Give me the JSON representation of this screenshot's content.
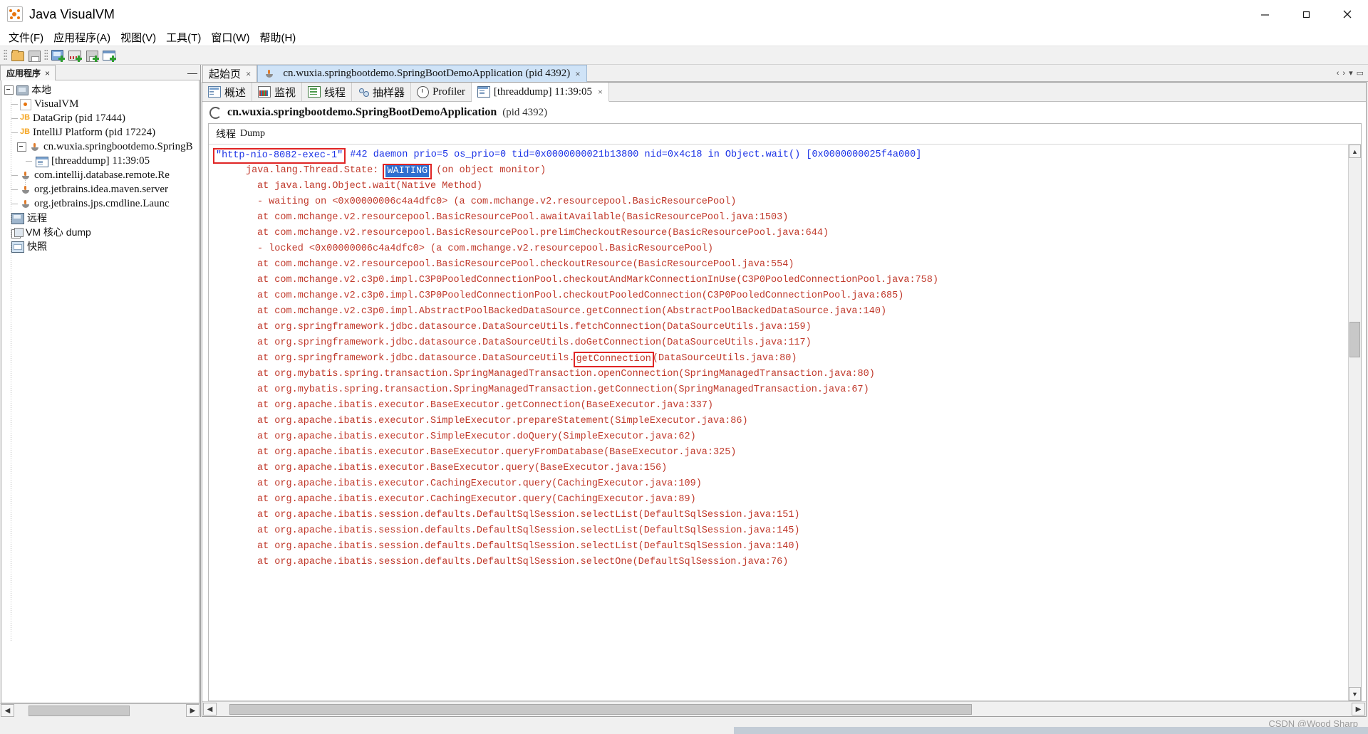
{
  "window": {
    "title": "Java VisualVM",
    "app_icon": "visualvm-icon",
    "minimize": "minimize-icon",
    "maximize": "maximize-icon",
    "close": "close-icon"
  },
  "menubar": {
    "items": [
      {
        "label": "文件(F)",
        "mnemonic": "F"
      },
      {
        "label": "应用程序(A)",
        "mnemonic": "A"
      },
      {
        "label": "视图(V)",
        "mnemonic": "V"
      },
      {
        "label": "工具(T)",
        "mnemonic": "T"
      },
      {
        "label": "窗口(W)",
        "mnemonic": "W"
      },
      {
        "label": "帮助(H)",
        "mnemonic": "H"
      }
    ]
  },
  "toolbar": {
    "buttons": [
      {
        "name": "open-file-icon"
      },
      {
        "name": "save-icon"
      },
      {
        "name": "add-jmx-connection-icon"
      },
      {
        "name": "add-remote-host-icon"
      },
      {
        "name": "add-vm-coredump-icon"
      },
      {
        "name": "add-snapshot-icon"
      }
    ]
  },
  "left_panel": {
    "tab_label": "应用程序",
    "tab_close": "×",
    "minimize_glyph": "—",
    "tree": [
      {
        "label": "本地",
        "depth": 0,
        "icon": "local-host-icon",
        "expandable": true,
        "expanded": true,
        "cjk": true
      },
      {
        "label": "VisualVM",
        "depth": 1,
        "icon": "visualvm-icon",
        "expandable": false,
        "cjk": false
      },
      {
        "label": "DataGrip (pid 17444)",
        "depth": 1,
        "icon": "jetbrains-icon",
        "expandable": false,
        "cjk": false
      },
      {
        "label": "IntelliJ Platform (pid 17224)",
        "depth": 1,
        "icon": "jetbrains-icon",
        "expandable": false,
        "cjk": false
      },
      {
        "label": "cn.wuxia.springbootdemo.SpringB",
        "depth": 1,
        "icon": "java-app-icon",
        "expandable": true,
        "expanded": true,
        "cjk": false
      },
      {
        "label": "[threaddump] 11:39:05",
        "depth": 2,
        "icon": "threaddump-icon",
        "expandable": false,
        "cjk": false
      },
      {
        "label": "com.intellij.database.remote.Re",
        "depth": 1,
        "icon": "java-app-icon",
        "expandable": false,
        "cjk": false
      },
      {
        "label": "org.jetbrains.idea.maven.server",
        "depth": 1,
        "icon": "java-app-icon",
        "expandable": false,
        "cjk": false
      },
      {
        "label": "org.jetbrains.jps.cmdline.Launc",
        "depth": 1,
        "icon": "java-app-icon",
        "expandable": false,
        "cjk": false
      },
      {
        "label": "远程",
        "depth": 0,
        "icon": "remote-host-icon",
        "expandable": false,
        "cjk": true
      },
      {
        "label": "VM 核心 dump",
        "depth": 0,
        "icon": "vm-coredump-icon",
        "expandable": false,
        "cjk": true
      },
      {
        "label": "快照",
        "depth": 0,
        "icon": "snapshot-icon",
        "expandable": false,
        "cjk": true
      }
    ]
  },
  "document_tabs": [
    {
      "label": "起始页",
      "closable": true,
      "active": false,
      "icon": null
    },
    {
      "label": "cn.wuxia.springbootdemo.SpringBootDemoApplication (pid 4392)",
      "closable": true,
      "active": true,
      "icon": "java-app-icon"
    }
  ],
  "sub_tabs": [
    {
      "label": "概述",
      "icon": "overview-icon",
      "active": false,
      "closable": false
    },
    {
      "label": "监视",
      "icon": "monitor-icon",
      "active": false,
      "closable": false
    },
    {
      "label": "线程",
      "icon": "threads-icon",
      "active": false,
      "closable": false
    },
    {
      "label": "抽样器",
      "icon": "sampler-icon",
      "active": false,
      "closable": false
    },
    {
      "label": "Profiler",
      "icon": "profiler-icon",
      "active": false,
      "closable": false
    },
    {
      "label": "[threaddump] 11:39:05",
      "icon": "threaddump-icon",
      "active": true,
      "closable": true
    }
  ],
  "app_header": {
    "spinner": "busy-spinner-icon",
    "name": "cn.wuxia.springbootdemo.SpringBootDemoApplication",
    "pid": "(pid 4392)"
  },
  "dump_panel": {
    "title_cjk": "线程",
    "title_en": "Dump"
  },
  "thread_dump": {
    "header": {
      "thread_name": "\"http-nio-8082-exec-1\"",
      "thread_name_boxed": true,
      "rest": " #42 daemon prio=5 os_prio=0 tid=0x0000000021b13800 nid=0x4c18 in Object.wait() [0x0000000025f4a000]"
    },
    "state_line": {
      "prefix": "java.lang.Thread.State: ",
      "state": "WAITING",
      "state_highlighted": true,
      "suffix": " (on object monitor)"
    },
    "lines": [
      {
        "indent": 2,
        "text": "at java.lang.Object.wait(Native Method)"
      },
      {
        "indent": 2,
        "text": "- waiting on <0x00000006c4a4dfc0> (a com.mchange.v2.resourcepool.BasicResourcePool)"
      },
      {
        "indent": 2,
        "text": "at com.mchange.v2.resourcepool.BasicResourcePool.awaitAvailable(BasicResourcePool.java:1503)"
      },
      {
        "indent": 2,
        "text": "at com.mchange.v2.resourcepool.BasicResourcePool.prelimCheckoutResource(BasicResourcePool.java:644)"
      },
      {
        "indent": 2,
        "text": "- locked <0x00000006c4a4dfc0> (a com.mchange.v2.resourcepool.BasicResourcePool)"
      },
      {
        "indent": 2,
        "text": "at com.mchange.v2.resourcepool.BasicResourcePool.checkoutResource(BasicResourcePool.java:554)"
      },
      {
        "indent": 2,
        "text": "at com.mchange.v2.c3p0.impl.C3P0PooledConnectionPool.checkoutAndMarkConnectionInUse(C3P0PooledConnectionPool.java:758)"
      },
      {
        "indent": 2,
        "text": "at com.mchange.v2.c3p0.impl.C3P0PooledConnectionPool.checkoutPooledConnection(C3P0PooledConnectionPool.java:685)"
      },
      {
        "indent": 2,
        "text": "at com.mchange.v2.c3p0.impl.AbstractPoolBackedDataSource.getConnection(AbstractPoolBackedDataSource.java:140)"
      },
      {
        "indent": 2,
        "text": "at org.springframework.jdbc.datasource.DataSourceUtils.fetchConnection(DataSourceUtils.java:159)"
      },
      {
        "indent": 2,
        "text": "at org.springframework.jdbc.datasource.DataSourceUtils.doGetConnection(DataSourceUtils.java:117)"
      },
      {
        "indent": 2,
        "text": "at org.springframework.jdbc.datasource.DataSourceUtils.",
        "boxed": "getConnection",
        "after": "(DataSourceUtils.java:80)"
      },
      {
        "indent": 2,
        "text": "at org.mybatis.spring.transaction.SpringManagedTransaction.openConnection(SpringManagedTransaction.java:80)"
      },
      {
        "indent": 2,
        "text": "at org.mybatis.spring.transaction.SpringManagedTransaction.getConnection(SpringManagedTransaction.java:67)"
      },
      {
        "indent": 2,
        "text": "at org.apache.ibatis.executor.BaseExecutor.getConnection(BaseExecutor.java:337)"
      },
      {
        "indent": 2,
        "text": "at org.apache.ibatis.executor.SimpleExecutor.prepareStatement(SimpleExecutor.java:86)"
      },
      {
        "indent": 2,
        "text": "at org.apache.ibatis.executor.SimpleExecutor.doQuery(SimpleExecutor.java:62)"
      },
      {
        "indent": 2,
        "text": "at org.apache.ibatis.executor.BaseExecutor.queryFromDatabase(BaseExecutor.java:325)"
      },
      {
        "indent": 2,
        "text": "at org.apache.ibatis.executor.BaseExecutor.query(BaseExecutor.java:156)"
      },
      {
        "indent": 2,
        "text": "at org.apache.ibatis.executor.CachingExecutor.query(CachingExecutor.java:109)"
      },
      {
        "indent": 2,
        "text": "at org.apache.ibatis.executor.CachingExecutor.query(CachingExecutor.java:89)"
      },
      {
        "indent": 2,
        "text": "at org.apache.ibatis.session.defaults.DefaultSqlSession.selectList(DefaultSqlSession.java:151)"
      },
      {
        "indent": 2,
        "text": "at org.apache.ibatis.session.defaults.DefaultSqlSession.selectList(DefaultSqlSession.java:145)"
      },
      {
        "indent": 2,
        "text": "at org.apache.ibatis.session.defaults.DefaultSqlSession.selectList(DefaultSqlSession.java:140)"
      },
      {
        "indent": 2,
        "text": "at org.apache.ibatis.session.defaults.DefaultSqlSession.selectOne(DefaultSqlSession.java:76)"
      }
    ]
  },
  "colors": {
    "dump_blue": "#1a32e6",
    "dump_red": "#c0392b",
    "box_red": "#e02424",
    "selection_blue": "#2f6fd0",
    "tab_active_blue": "#cfe3f7"
  },
  "scrollbars": {
    "left_h_left_arrow": "◀",
    "left_h_right_arrow": "▶",
    "main_h_left_arrow": "◀",
    "main_h_right_arrow": "▶",
    "v_up_arrow": "▲",
    "v_down_arrow": "▼"
  },
  "watermark": "CSDN @Wood Sharp"
}
